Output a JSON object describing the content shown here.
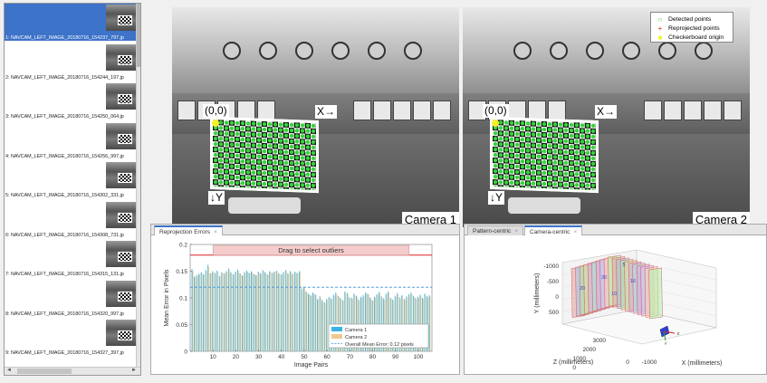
{
  "image_list": {
    "items": [
      {
        "label": "1: NAVCAM_LEFT_IMAGE_20180716_154237_797.jp",
        "selected": true
      },
      {
        "label": "2: NAVCAM_LEFT_IMAGE_20180716_154244_197.jp",
        "selected": false
      },
      {
        "label": "3: NAVCAM_LEFT_IMAGE_20180716_154250_064.jp",
        "selected": false
      },
      {
        "label": "4: NAVCAM_LEFT_IMAGE_20180716_154256_997.jp",
        "selected": false
      },
      {
        "label": "5: NAVCAM_LEFT_IMAGE_20180716_154302_331.jp",
        "selected": false
      },
      {
        "label": "6: NAVCAM_LEFT_IMAGE_20180716_154308_731.jp",
        "selected": false
      },
      {
        "label": "7: NAVCAM_LEFT_IMAGE_20180716_154315_131.jp",
        "selected": false
      },
      {
        "label": "8: NAVCAM_LEFT_IMAGE_20180716_154320_997.jp",
        "selected": false
      },
      {
        "label": "9: NAVCAM_LEFT_IMAGE_20180716_154327_397.jp",
        "selected": false
      }
    ],
    "scroll_left": "◄",
    "scroll_right": "►"
  },
  "camera_views": {
    "camera1_label": "Camera 1",
    "camera2_label": "Camera 2",
    "origin_label": "(0,0)",
    "x_axis_label": "X→",
    "y_axis_label": "↓Y",
    "legend": {
      "detected": {
        "symbol": "○",
        "label": "Detected points",
        "color": "#35d43a"
      },
      "reprojected": {
        "symbol": "+",
        "label": "Reprojected points",
        "color": "#e0261b"
      },
      "origin": {
        "symbol": "■",
        "label": "Checkerboard origin",
        "color": "#f5f02a"
      }
    }
  },
  "reprojection_panel": {
    "tab_label": "Reprojection Errors",
    "tab_close": "×"
  },
  "camera_view_panel": {
    "tabs": [
      {
        "label": "Pattern-centric",
        "active": false
      },
      {
        "label": "Camera-centric",
        "active": true
      }
    ],
    "tab_close": "×"
  },
  "chart_data": [
    {
      "type": "bar",
      "xlabel": "Image Pairs",
      "ylabel": "Mean Error in Pixels",
      "xlim": [
        0,
        106
      ],
      "ylim": [
        0,
        0.2
      ],
      "xticks": [
        10,
        20,
        30,
        40,
        50,
        60,
        70,
        80,
        90,
        100
      ],
      "yticks": [
        0,
        0.05,
        0.1,
        0.15,
        0.2
      ],
      "ytick_labels": [
        "0",
        "0.05",
        "0.1",
        "0.15",
        "0.2"
      ],
      "drag_label": "Drag to select outliers",
      "outlier_threshold": 0.18,
      "overall_mean_error": 0.12,
      "legend_position": "bottom-right",
      "series": [
        {
          "name": "Camera 1",
          "color": "#39b3e6",
          "values": [
            0.154,
            0.14,
            0.143,
            0.145,
            0.148,
            0.144,
            0.152,
            0.162,
            0.146,
            0.15,
            0.147,
            0.151,
            0.141,
            0.148,
            0.146,
            0.15,
            0.155,
            0.148,
            0.144,
            0.149,
            0.153,
            0.146,
            0.142,
            0.148,
            0.151,
            0.147,
            0.15,
            0.145,
            0.143,
            0.149,
            0.146,
            0.152,
            0.148,
            0.144,
            0.15,
            0.147,
            0.149,
            0.151,
            0.146,
            0.144,
            0.148,
            0.152,
            0.146,
            0.15,
            0.145,
            0.149,
            0.147,
            0.15,
            0.118,
            0.12,
            0.112,
            0.108,
            0.105,
            0.11,
            0.107,
            0.098,
            0.103,
            0.096,
            0.092,
            0.098,
            0.102,
            0.099,
            0.106,
            0.11,
            0.104,
            0.1,
            0.096,
            0.112,
            0.109,
            0.101,
            0.1,
            0.108,
            0.104,
            0.097,
            0.102,
            0.105,
            0.11,
            0.108,
            0.101,
            0.096,
            0.102,
            0.107,
            0.111,
            0.103,
            0.099,
            0.108,
            0.112,
            0.1,
            0.097,
            0.104,
            0.109,
            0.101,
            0.105,
            0.098,
            0.103,
            0.107,
            0.11,
            0.104,
            0.1,
            0.102,
            0.106,
            0.1,
            0.108,
            0.103,
            0.105
          ]
        },
        {
          "name": "Camera 2",
          "color": "#efc98f",
          "values": [
            0.15,
            0.138,
            0.141,
            0.144,
            0.146,
            0.143,
            0.15,
            0.158,
            0.145,
            0.148,
            0.146,
            0.149,
            0.14,
            0.147,
            0.145,
            0.149,
            0.153,
            0.147,
            0.143,
            0.148,
            0.151,
            0.145,
            0.141,
            0.147,
            0.149,
            0.146,
            0.148,
            0.144,
            0.142,
            0.148,
            0.145,
            0.15,
            0.147,
            0.143,
            0.149,
            0.146,
            0.148,
            0.15,
            0.145,
            0.143,
            0.147,
            0.15,
            0.145,
            0.149,
            0.144,
            0.148,
            0.146,
            0.149,
            0.116,
            0.118,
            0.11,
            0.106,
            0.103,
            0.108,
            0.105,
            0.096,
            0.101,
            0.094,
            0.09,
            0.096,
            0.1,
            0.097,
            0.104,
            0.108,
            0.102,
            0.098,
            0.094,
            0.11,
            0.107,
            0.099,
            0.098,
            0.106,
            0.102,
            0.095,
            0.1,
            0.103,
            0.108,
            0.106,
            0.099,
            0.094,
            0.1,
            0.105,
            0.109,
            0.101,
            0.097,
            0.106,
            0.11,
            0.098,
            0.095,
            0.102,
            0.107,
            0.099,
            0.103,
            0.096,
            0.101,
            0.105,
            0.108,
            0.102,
            0.098,
            0.1,
            0.104,
            0.098,
            0.106,
            0.101,
            0.103
          ]
        }
      ],
      "mean_line_label": "Overall Mean Error: 0.12 pixels",
      "legend": [
        "Camera 1",
        "Camera 2",
        "Overall Mean Error: 0.12 pixels"
      ]
    },
    {
      "type": "scatter",
      "xlabel": "X (millimeters)",
      "ylabel": "Y (millimeters)",
      "zlabel": "Z (millimeters)",
      "yticks": [
        "-1000",
        "-500",
        "0",
        "500"
      ],
      "zticks": [
        "3000",
        "2000",
        "1000",
        "0"
      ],
      "xticks": [
        "0",
        "-1000"
      ],
      "camera_axis_labels": [
        "Y",
        "Z"
      ],
      "board_labels": [
        "5",
        "30",
        "20",
        "10",
        "16"
      ],
      "grid": true
    }
  ]
}
